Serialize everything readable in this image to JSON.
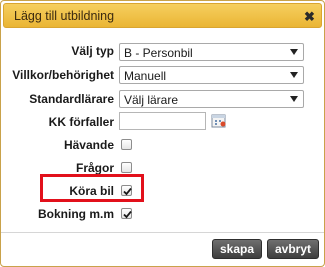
{
  "dialog": {
    "title": "Lägg till utbildning",
    "close_icon": "close-icon"
  },
  "form": {
    "valj_typ": {
      "label": "Välj typ",
      "value": "B - Personbil"
    },
    "villkor": {
      "label": "Villkor/behörighet",
      "value": "Manuell"
    },
    "standardlarare": {
      "label": "Standardlärare",
      "value": "Välj lärare"
    },
    "kk_forfaller": {
      "label": "KK förfaller",
      "value": "",
      "icon": "calendar-icon"
    },
    "havande": {
      "label": "Hävande",
      "checked": false
    },
    "fragor": {
      "label": "Frågor",
      "checked": false
    },
    "kora_bil": {
      "label": "Köra bil",
      "checked": true,
      "highlight_color": "#e2101b"
    },
    "bokning": {
      "label": "Bokning m.m",
      "checked": true
    }
  },
  "buttons": {
    "create": "skapa",
    "cancel": "avbryt"
  },
  "colors": {
    "title_bar": "#eab534",
    "button": "#4a4a4a"
  }
}
